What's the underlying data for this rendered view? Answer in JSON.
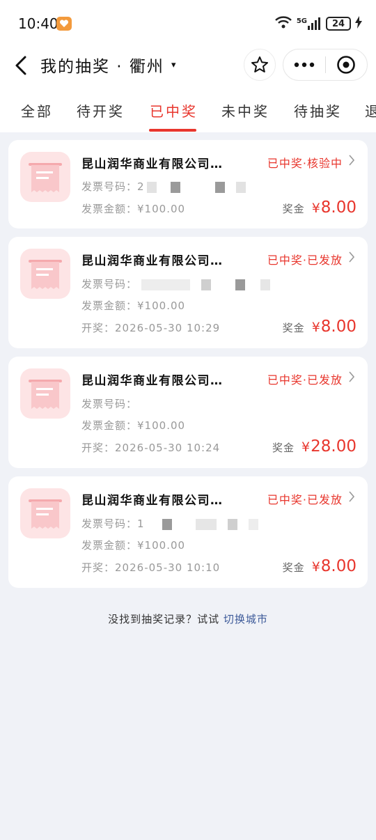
{
  "status_bar": {
    "time": "10:40",
    "network": "5G",
    "battery": "24"
  },
  "nav": {
    "title": "我的抽奖 · 衢州",
    "caret": "▾"
  },
  "tabs": [
    "全部",
    "待开奖",
    "已中奖",
    "未中奖",
    "待抽奖",
    "退"
  ],
  "active_tab": "已中奖",
  "cards": [
    {
      "company": "昆山润华商业有限公司…",
      "status": "已中奖·核验中",
      "invoice_label": "发票号码：",
      "invoice_prefix": "2",
      "amount_label": "发票金额：",
      "amount": "¥100.00",
      "draw_label": "",
      "draw_time": "",
      "prize_label": "奖金",
      "prize_currency": "¥",
      "prize": "8.00"
    },
    {
      "company": "昆山润华商业有限公司…",
      "status": "已中奖·已发放",
      "invoice_label": "发票号码：",
      "invoice_prefix": "",
      "amount_label": "发票金额：",
      "amount": "¥100.00",
      "draw_label": "开奖：",
      "draw_time": "2026-05-30 10:29",
      "prize_label": "奖金",
      "prize_currency": "¥",
      "prize": "8.00"
    },
    {
      "company": "昆山润华商业有限公司…",
      "status": "已中奖·已发放",
      "invoice_label": "发票号码：",
      "invoice_prefix": "",
      "amount_label": "发票金额：",
      "amount": "¥100.00",
      "draw_label": "开奖：",
      "draw_time": "2026-05-30 10:24",
      "prize_label": "奖金",
      "prize_currency": "¥",
      "prize": "28.00"
    },
    {
      "company": "昆山润华商业有限公司…",
      "status": "已中奖·已发放",
      "invoice_label": "发票号码：",
      "invoice_prefix": "1",
      "amount_label": "发票金额：",
      "amount": "¥100.00",
      "draw_label": "开奖：",
      "draw_time": "2026-05-30 10:10",
      "prize_label": "奖金",
      "prize_currency": "¥",
      "prize": "8.00"
    }
  ],
  "footer": {
    "text": "没找到抽奖记录？试试 ",
    "link": "切换城市"
  },
  "colors": {
    "accent": "#e8362d",
    "link": "#3d5a99",
    "background": "#f0f2f7",
    "receipt_bg": "#fde4e5"
  }
}
